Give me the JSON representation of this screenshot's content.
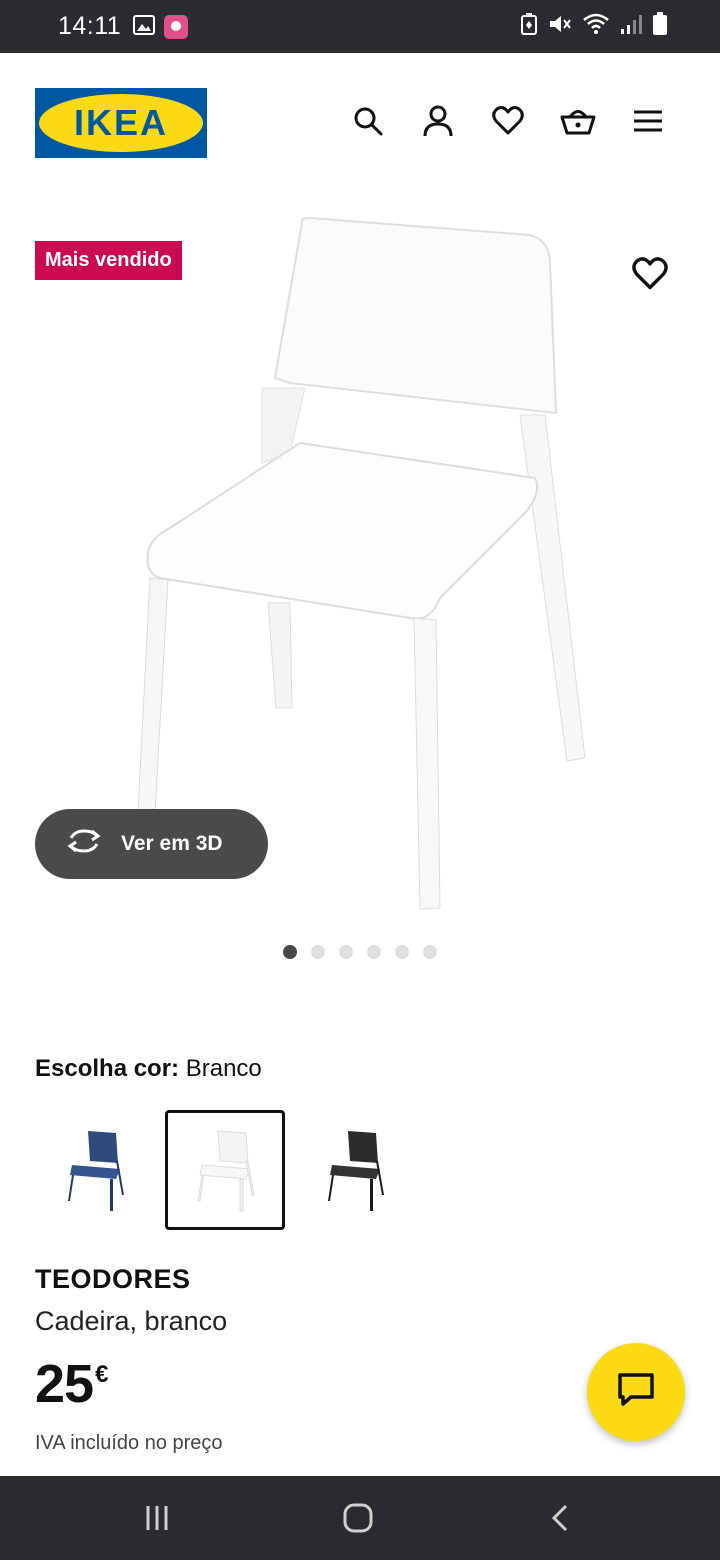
{
  "status_bar": {
    "time": "14:11",
    "left_icons": [
      "gallery-icon",
      "app-notification-icon"
    ],
    "right_icons": [
      "battery-saver-icon",
      "mute-icon",
      "wifi-icon",
      "signal-icon",
      "battery-icon"
    ]
  },
  "header": {
    "logo_text": "IKEA",
    "icons": [
      "search-icon",
      "profile-icon",
      "favorites-icon",
      "cart-icon",
      "menu-icon"
    ]
  },
  "product": {
    "badge": "Mais vendido",
    "view_3d_label": "Ver em 3D",
    "carousel": {
      "total": 6,
      "active_index": 0
    },
    "color": {
      "label": "Escolha cor:",
      "selected": "Branco",
      "options": [
        "blue",
        "white",
        "black"
      ],
      "selected_index": 1
    },
    "name": "TEODORES",
    "description": "Cadeira, branco",
    "price": "25",
    "currency": "€",
    "vat_note": "IVA incluído no preço"
  },
  "colors": {
    "badge": "#cc0a52",
    "logo_blue": "#0058a3",
    "logo_yellow": "#fbd914",
    "chat_fab": "#fbd914"
  }
}
